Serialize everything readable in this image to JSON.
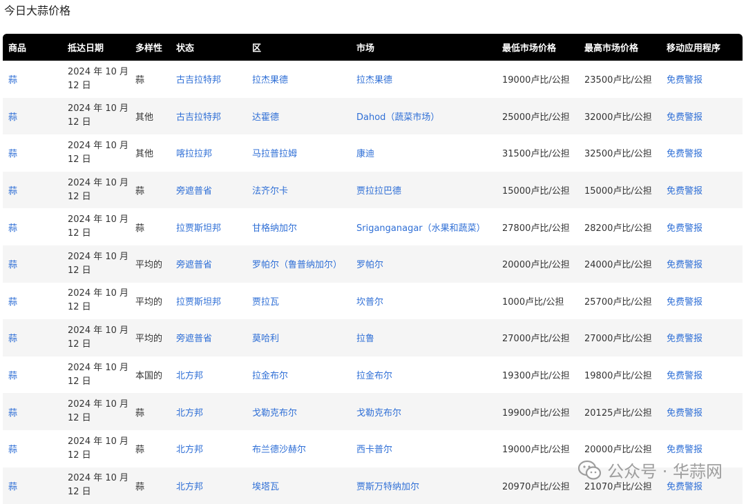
{
  "page": {
    "title": "今日大蒜价格"
  },
  "table": {
    "headers": [
      "商品",
      "抵达日期",
      "多样性",
      "状态",
      "区",
      "市场",
      "最低市场价格",
      "最高市场价格",
      "移动应用程序"
    ],
    "rows": [
      {
        "commodity": "蒜",
        "date_line1": "2024 年 10 月",
        "date_line2": "12 日",
        "variety": "蒜",
        "state": "古吉拉特邦",
        "district": "拉杰果德",
        "market": "拉杰果德",
        "min": "19000卢比/公担",
        "max": "23500卢比/公担",
        "app": "免费警报"
      },
      {
        "commodity": "蒜",
        "date_line1": "2024 年 10 月",
        "date_line2": "12 日",
        "variety": "其他",
        "state": "古吉拉特邦",
        "district": "达霍德",
        "market": "Dahod（蔬菜市场）",
        "min": "25000卢比/公担",
        "max": "32000卢比/公担",
        "app": "免费警报"
      },
      {
        "commodity": "蒜",
        "date_line1": "2024 年 10 月",
        "date_line2": "12 日",
        "variety": "其他",
        "state": "喀拉拉邦",
        "district": "马拉普拉姆",
        "market": "康迪",
        "min": "31500卢比/公担",
        "max": "32500卢比/公担",
        "app": "免费警报"
      },
      {
        "commodity": "蒜",
        "date_line1": "2024 年 10 月",
        "date_line2": "12 日",
        "variety": "蒜",
        "state": "旁遮普省",
        "district": "法齐尔卡",
        "market": "贾拉拉巴德",
        "min": "15000卢比/公担",
        "max": "15000卢比/公担",
        "app": "免费警报"
      },
      {
        "commodity": "蒜",
        "date_line1": "2024 年 10 月",
        "date_line2": "12 日",
        "variety": "蒜",
        "state": "拉贾斯坦邦",
        "district": "甘格纳加尔",
        "market": "Sriganganagar（水果和蔬菜）",
        "min": "27800卢比/公担",
        "max": "28200卢比/公担",
        "app": "免费警报"
      },
      {
        "commodity": "蒜",
        "date_line1": "2024 年 10 月",
        "date_line2": "12 日",
        "variety": "平均的",
        "state": "旁遮普省",
        "district": "罗帕尔（鲁普纳加尔）",
        "market": "罗帕尔",
        "min": "20000卢比/公担",
        "max": "24000卢比/公担",
        "app": "免费警报"
      },
      {
        "commodity": "蒜",
        "date_line1": "2024 年 10 月",
        "date_line2": "12 日",
        "variety": "平均的",
        "state": "拉贾斯坦邦",
        "district": "贾拉瓦",
        "market": "坎普尔",
        "min": "1000卢比/公担",
        "max": "25700卢比/公担",
        "app": "免费警报"
      },
      {
        "commodity": "蒜",
        "date_line1": "2024 年 10 月",
        "date_line2": "12 日",
        "variety": "平均的",
        "state": "旁遮普省",
        "district": "莫哈利",
        "market": "拉鲁",
        "min": "27000卢比/公担",
        "max": "27000卢比/公担",
        "app": "免费警报"
      },
      {
        "commodity": "蒜",
        "date_line1": "2024 年 10 月",
        "date_line2": "12 日",
        "variety": "本国的",
        "state": "北方邦",
        "district": "拉金布尔",
        "market": "拉金布尔",
        "min": "19300卢比/公担",
        "max": "19800卢比/公担",
        "app": "免费警报"
      },
      {
        "commodity": "蒜",
        "date_line1": "2024 年 10 月",
        "date_line2": "12 日",
        "variety": "蒜",
        "state": "北方邦",
        "district": "戈勒克布尔",
        "market": "戈勒克布尔",
        "min": "19900卢比/公担",
        "max": "20125卢比/公担",
        "app": "免费警报"
      },
      {
        "commodity": "蒜",
        "date_line1": "2024 年 10 月",
        "date_line2": "12 日",
        "variety": "蒜",
        "state": "北方邦",
        "district": "布兰德沙赫尔",
        "market": "西卡普尔",
        "min": "19000卢比/公担",
        "max": "20000卢比/公担",
        "app": "免费警报"
      },
      {
        "commodity": "蒜",
        "date_line1": "2024 年 10 月",
        "date_line2": "12 日",
        "variety": "蒜",
        "state": "北方邦",
        "district": "埃塔瓦",
        "market": "贾斯万特纳加尔",
        "min": "20970卢比/公担",
        "max": "21070卢比/公担",
        "app": "免费警报"
      }
    ]
  },
  "watermark": {
    "text": "公众号 · 华蒜网",
    "icon": "wechat-icon"
  },
  "colors": {
    "header_bg": "#000000",
    "link": "#2f6fd6",
    "stripe": "#f5f5f5"
  }
}
